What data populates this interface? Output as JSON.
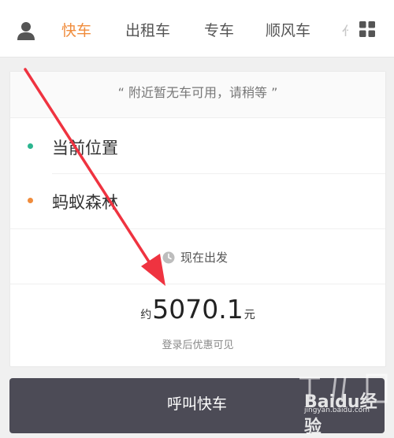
{
  "tabs": [
    {
      "label": "快车",
      "active": true
    },
    {
      "label": "出租车",
      "active": false
    },
    {
      "label": "专车",
      "active": false
    },
    {
      "label": "顺风车",
      "active": false
    }
  ],
  "tab_overflow_label": "代",
  "notice": "“ 附近暂无车可用，请稍等 ”",
  "pickup": "当前位置",
  "destination": "蚂蚁森林",
  "depart_time": "现在出发",
  "price": {
    "prefix": "约",
    "amount": "5070.1",
    "suffix": "元",
    "note": "登录后优惠可见"
  },
  "call_button": "呼叫快车",
  "watermark": {
    "text": "Baidu经验",
    "sub": "jingyan.baidu.com"
  },
  "colors": {
    "accent": "#f08c3c",
    "pickup_dot": "#2bb58f",
    "destination_dot": "#f08c3c",
    "button_bg": "#4c4b56",
    "arrow": "#ef3340"
  },
  "icons": {
    "profile": "user-silhouette-icon",
    "menu": "grid-four-squares-icon",
    "clock": "clock-icon"
  }
}
